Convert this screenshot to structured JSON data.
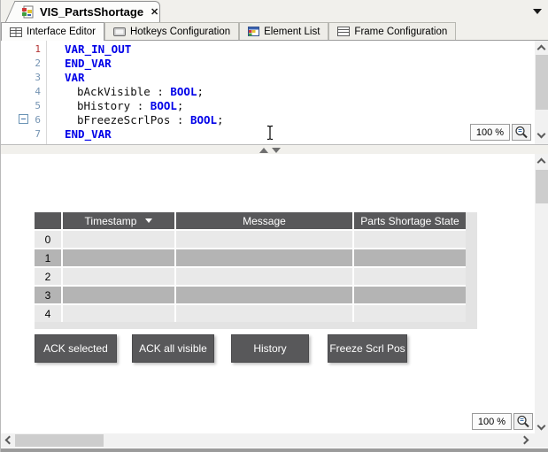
{
  "icons": {
    "close": "✕"
  },
  "document_tab": {
    "title": "VIS_PartsShortage"
  },
  "tabs": [
    {
      "label": "Interface Editor",
      "active": true
    },
    {
      "label": "Hotkeys Configuration",
      "active": false
    },
    {
      "label": "Element List",
      "active": false
    },
    {
      "label": "Frame Configuration",
      "active": false
    }
  ],
  "editor": {
    "zoom": "100 %",
    "lines": [
      {
        "no": "1",
        "keyword": "VAR_IN_OUT"
      },
      {
        "no": "2",
        "keyword": "END_VAR"
      },
      {
        "no": "3",
        "keyword": "VAR"
      },
      {
        "no": "4",
        "name": "bAckVisible",
        "sep": " : ",
        "type": "BOOL",
        "term": ";"
      },
      {
        "no": "5",
        "name": "bHistory",
        "sep": " : ",
        "type": "BOOL",
        "term": ";"
      },
      {
        "no": "6",
        "name": "bFreezeScrlPos",
        "sep": " : ",
        "type": "BOOL",
        "term": ";"
      },
      {
        "no": "7",
        "keyword": "END_VAR"
      }
    ]
  },
  "viz": {
    "zoom": "100 %",
    "table": {
      "headers": {
        "index": "",
        "timestamp": "Timestamp",
        "message": "Message",
        "state": "Parts Shortage State"
      },
      "rows": [
        "0",
        "1",
        "2",
        "3",
        "4"
      ]
    },
    "buttons": [
      "ACK selected",
      "ACK all visible",
      "History",
      "Freeze Scrl Pos"
    ]
  },
  "colors": {
    "accent_dark": "#58585a",
    "row_light": "#e9e9e9",
    "row_dark": "#b4b4b4",
    "keyword_blue": "#0000e8",
    "line_number": "#7594b3",
    "line_number_current": "#b23333"
  }
}
